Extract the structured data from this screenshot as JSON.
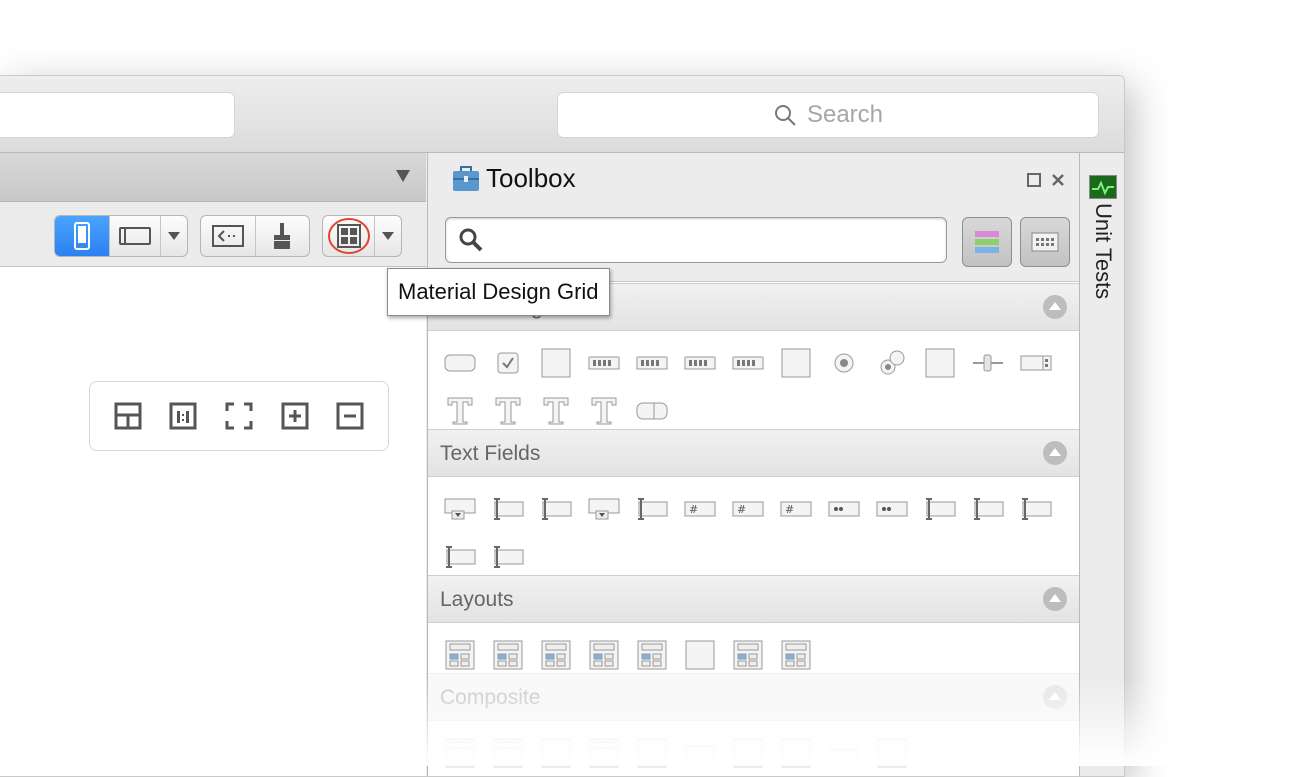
{
  "search": {
    "placeholder": "Search"
  },
  "tooltip": {
    "text": "Material Design Grid"
  },
  "toolbox": {
    "title": "Toolbox",
    "sections": [
      {
        "label": "Form Widgets"
      },
      {
        "label": "Text Fields"
      },
      {
        "label": "Layouts"
      },
      {
        "label": "Composite"
      }
    ]
  },
  "side_panel": {
    "label": "Unit Tests"
  },
  "colors": {
    "accent": "#2b81f0",
    "highlight_circle": "#e0442c"
  }
}
